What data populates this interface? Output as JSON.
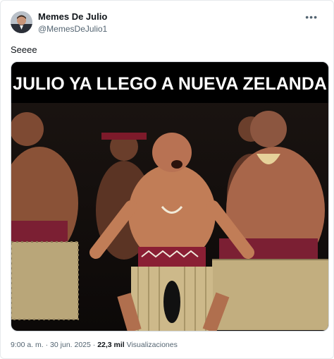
{
  "author": {
    "name": "Memes De Julio",
    "handle": "@MemesDeJulio1"
  },
  "tweet": {
    "text": "Seeee"
  },
  "media": {
    "caption": "JULIO YA LLEGO A NUEVA ZELANDA"
  },
  "meta": {
    "time": "9:00 a. m.",
    "separator": " · ",
    "date": "30 jun. 2025",
    "views_count": "22,3 mil",
    "views_label": "Visualizaciones"
  },
  "icons": {
    "more": "more-options-icon"
  }
}
